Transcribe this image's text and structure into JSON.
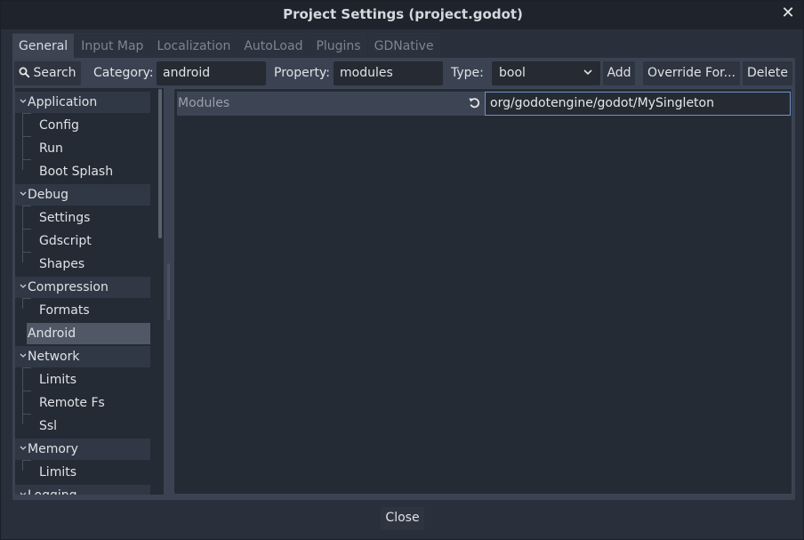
{
  "window": {
    "title": "Project Settings (project.godot)",
    "close_glyph": "✕"
  },
  "tabs": [
    {
      "label": "General",
      "active": true
    },
    {
      "label": "Input Map",
      "active": false
    },
    {
      "label": "Localization",
      "active": false
    },
    {
      "label": "AutoLoad",
      "active": false
    },
    {
      "label": "Plugins",
      "active": false
    },
    {
      "label": "GDNative",
      "active": false
    }
  ],
  "toolbar": {
    "search_label": "Search",
    "category_label": "Category:",
    "category_value": "android",
    "property_label": "Property:",
    "property_value": "modules",
    "type_label": "Type:",
    "type_value": "bool",
    "add_label": "Add",
    "override_label": "Override For...",
    "delete_label": "Delete"
  },
  "tree": [
    {
      "label": "Application",
      "kind": "category"
    },
    {
      "label": "Config",
      "kind": "child"
    },
    {
      "label": "Run",
      "kind": "child"
    },
    {
      "label": "Boot Splash",
      "kind": "child"
    },
    {
      "label": "Debug",
      "kind": "category"
    },
    {
      "label": "Settings",
      "kind": "child"
    },
    {
      "label": "Gdscript",
      "kind": "child"
    },
    {
      "label": "Shapes",
      "kind": "child"
    },
    {
      "label": "Compression",
      "kind": "category"
    },
    {
      "label": "Formats",
      "kind": "child"
    },
    {
      "label": "Android",
      "kind": "selected"
    },
    {
      "label": "Network",
      "kind": "category"
    },
    {
      "label": "Limits",
      "kind": "child"
    },
    {
      "label": "Remote Fs",
      "kind": "child"
    },
    {
      "label": "Ssl",
      "kind": "child"
    },
    {
      "label": "Memory",
      "kind": "category"
    },
    {
      "label": "Limits",
      "kind": "child"
    },
    {
      "label": "Logging",
      "kind": "category"
    }
  ],
  "property": {
    "name": "Modules",
    "value": "org/godotengine/godot/MySingleton"
  },
  "footer": {
    "close_label": "Close"
  },
  "colors": {
    "accent": "#6f93c8",
    "panel": "#3b4352",
    "background": "#252b35"
  }
}
